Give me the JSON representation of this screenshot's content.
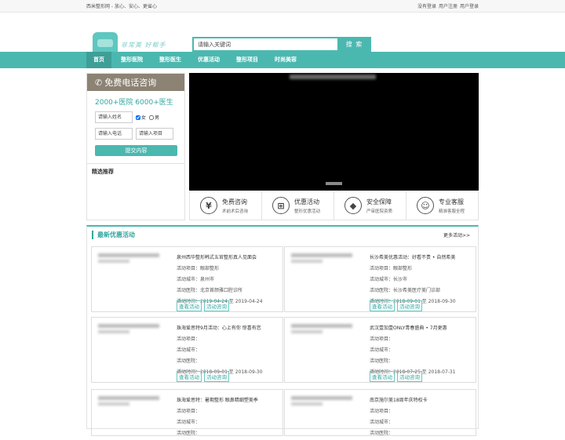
{
  "topbar": {
    "slogan": "西米整形网 - 放心、安心、更省心",
    "links": [
      "没有登录",
      "用户注册",
      "用户登录"
    ]
  },
  "logo": {
    "text": "非常美 好帮手"
  },
  "search": {
    "placeholder": "请输入关键词",
    "button": "搜 索"
  },
  "nav": {
    "items": [
      {
        "label": "首页",
        "active": true
      },
      {
        "label": "整形医院"
      },
      {
        "label": "整形医生"
      },
      {
        "label": "优惠活动"
      },
      {
        "label": "整形项目"
      },
      {
        "label": "时尚美容"
      }
    ]
  },
  "consult": {
    "banner": "免费电话咨询",
    "stats": "2000+医院 6000+医生",
    "name_placeholder": "请输入姓名",
    "female": "女",
    "male": "男",
    "phone_placeholder": "请输入电话",
    "project_placeholder": "请输入项目",
    "submit": "提交内容",
    "recommend_title": "精选推荐"
  },
  "features": [
    {
      "icon": "yen-icon",
      "glyph": "¥",
      "title": "免费咨询",
      "sub": "术前术后咨询"
    },
    {
      "icon": "basket-icon",
      "glyph": "⊞",
      "title": "优惠活动",
      "sub": "整形优惠活动"
    },
    {
      "icon": "shield-icon",
      "glyph": "◆",
      "title": "安全保障",
      "sub": "严审医院资质"
    },
    {
      "icon": "agent-icon",
      "glyph": "☺",
      "title": "专业客服",
      "sub": "精准客服全程"
    }
  ],
  "promo": {
    "title": "最新优惠活动",
    "more": "更多活动>>",
    "labels": {
      "project": "活动项目：",
      "city": "活动城市：",
      "hospital": "活动医院：",
      "time": "活动时间："
    },
    "view_btn": "查看活动",
    "consult_btn": "活动咨询",
    "cards": [
      {
        "name": "泉州西华整形韩式五官整形真人见面会",
        "project": "眼部整形",
        "city": "泉州市",
        "hospital": "北京首颜雅口腔诊所",
        "time": "2019-04-24 至 2019-04-24"
      },
      {
        "name": "长沙希美优惠活动：好看不贵 • 自然希美",
        "project": "眼部整形",
        "city": "长沙市",
        "hospital": "长沙希美医疗美门诊部",
        "time": "2018-09-01 至 2018-09-30"
      },
      {
        "name": "珠海爱思特9月活动：心上有你 惊喜有您",
        "project": "",
        "city": "",
        "hospital": "",
        "time": "2018-09-01 至 2018-09-30"
      },
      {
        "name": "武汉壹加壹ONLY青春盛典 • 7月更惠",
        "project": "",
        "city": "",
        "hospital": "",
        "time": "2018-07-25 至 2018-07-31"
      },
      {
        "name": "珠海爱思特：暑期整形 眼鼻精细塑美季",
        "project": "",
        "city": "",
        "hospital": "",
        "time": ""
      },
      {
        "name": "南京施尔美18周年庆特权卡",
        "project": "",
        "city": "",
        "hospital": "",
        "time": ""
      }
    ]
  }
}
